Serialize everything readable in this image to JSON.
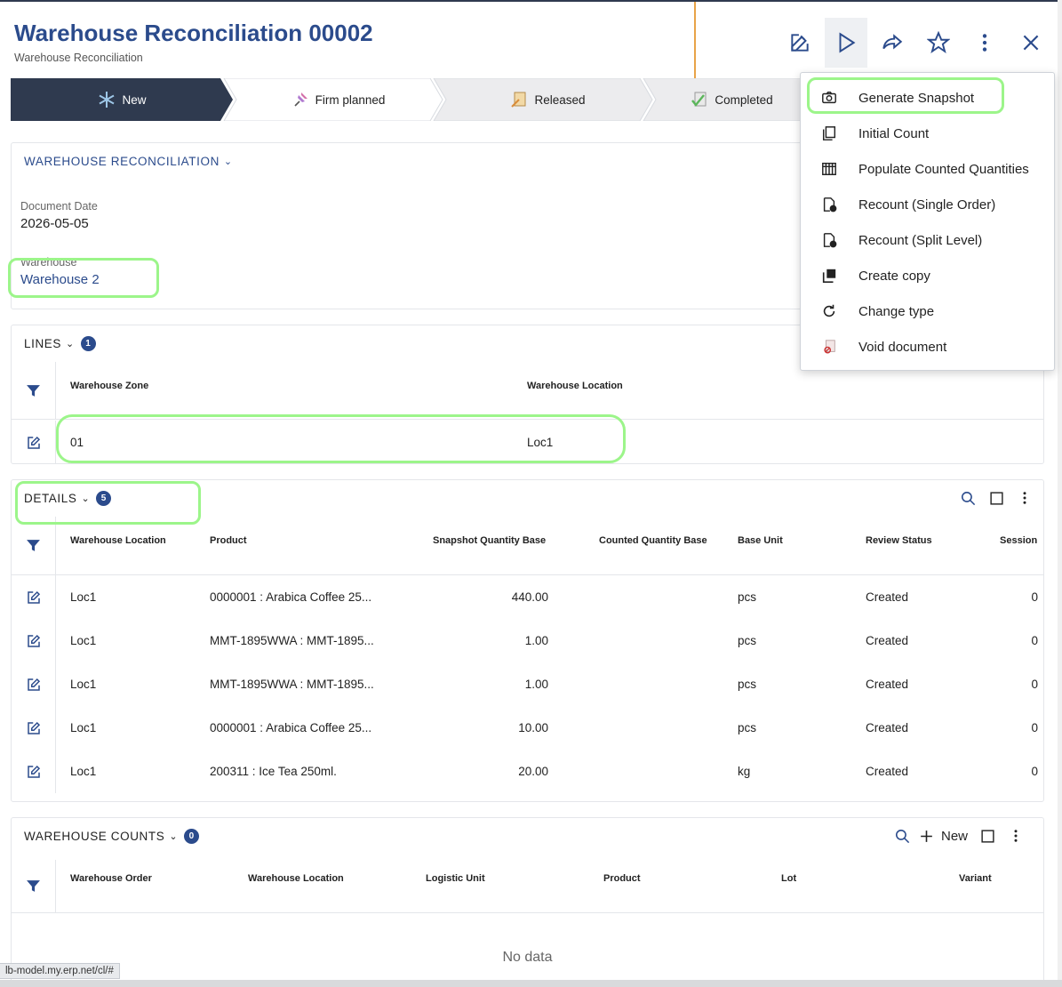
{
  "header": {
    "title": "Warehouse Reconciliation 00002",
    "subtitle": "Warehouse Reconciliation"
  },
  "toolbar": {
    "buttons": [
      "edit-icon",
      "play-icon",
      "share-icon",
      "star-icon",
      "more-vertical-icon",
      "close-icon"
    ]
  },
  "stepper": {
    "steps": [
      {
        "label": "New",
        "active": true
      },
      {
        "label": "Firm planned",
        "active": false
      },
      {
        "label": "Released",
        "active": false
      },
      {
        "label": "Completed",
        "active": false
      }
    ]
  },
  "general": {
    "section_title": "WAREHOUSE RECONCILIATION",
    "document_date_label": "Document Date",
    "document_date": "2026-05-05",
    "warehouse_label": "Warehouse",
    "warehouse": "Warehouse 2"
  },
  "lines": {
    "title": "LINES",
    "count": "1",
    "columns": [
      "Warehouse Zone",
      "Warehouse Location"
    ],
    "rows": [
      {
        "zone": "01",
        "location": "Loc1"
      }
    ]
  },
  "details": {
    "title": "DETAILS",
    "count": "5",
    "columns": {
      "location": "Warehouse Location",
      "product": "Product",
      "snapshot": "Snapshot Quantity Base",
      "counted": "Counted Quantity Base",
      "unit": "Base Unit",
      "status": "Review Status",
      "session": "Session"
    },
    "rows": [
      {
        "location": "Loc1",
        "product": "0000001 : Arabica Coffee 25...",
        "snapshot": "440.00",
        "counted": "",
        "unit": "pcs",
        "status": "Created",
        "session": "0"
      },
      {
        "location": "Loc1",
        "product": "MMT-1895WWA : MMT-1895...",
        "snapshot": "1.00",
        "counted": "",
        "unit": "pcs",
        "status": "Created",
        "session": "0"
      },
      {
        "location": "Loc1",
        "product": "MMT-1895WWA : MMT-1895...",
        "snapshot": "1.00",
        "counted": "",
        "unit": "pcs",
        "status": "Created",
        "session": "0"
      },
      {
        "location": "Loc1",
        "product": "0000001 : Arabica Coffee 25...",
        "snapshot": "10.00",
        "counted": "",
        "unit": "pcs",
        "status": "Created",
        "session": "0"
      },
      {
        "location": "Loc1",
        "product": "200311 : Ice Tea 250ml.",
        "snapshot": "20.00",
        "counted": "",
        "unit": "kg",
        "status": "Created",
        "session": "0"
      }
    ]
  },
  "counts": {
    "title": "WAREHOUSE COUNTS",
    "count": "0",
    "new_label": "New",
    "columns": {
      "order": "Warehouse Order",
      "location": "Warehouse Location",
      "logistic_unit": "Logistic Unit",
      "product": "Product",
      "lot": "Lot",
      "variant": "Variant"
    },
    "empty_text": "No data"
  },
  "menu": {
    "items": [
      {
        "label": "Generate Snapshot",
        "icon": "camera-icon"
      },
      {
        "label": "Initial Count",
        "icon": "copy-pages-icon"
      },
      {
        "label": "Populate Counted Quantities",
        "icon": "table-grid-icon"
      },
      {
        "label": "Recount (Single Order)",
        "icon": "document-check-icon"
      },
      {
        "label": "Recount (Split Level)",
        "icon": "document-check-icon"
      },
      {
        "label": "Create copy",
        "icon": "duplicate-icon"
      },
      {
        "label": "Change type",
        "icon": "refresh-icon"
      },
      {
        "label": "Void document",
        "icon": "void-document-icon"
      }
    ]
  },
  "status_bar": {
    "url": "lb-model.my.erp.net/cl/#"
  },
  "colors": {
    "primary": "#2b4b8c",
    "active_step": "#2f3a4f",
    "highlight": "#9cf58a"
  }
}
